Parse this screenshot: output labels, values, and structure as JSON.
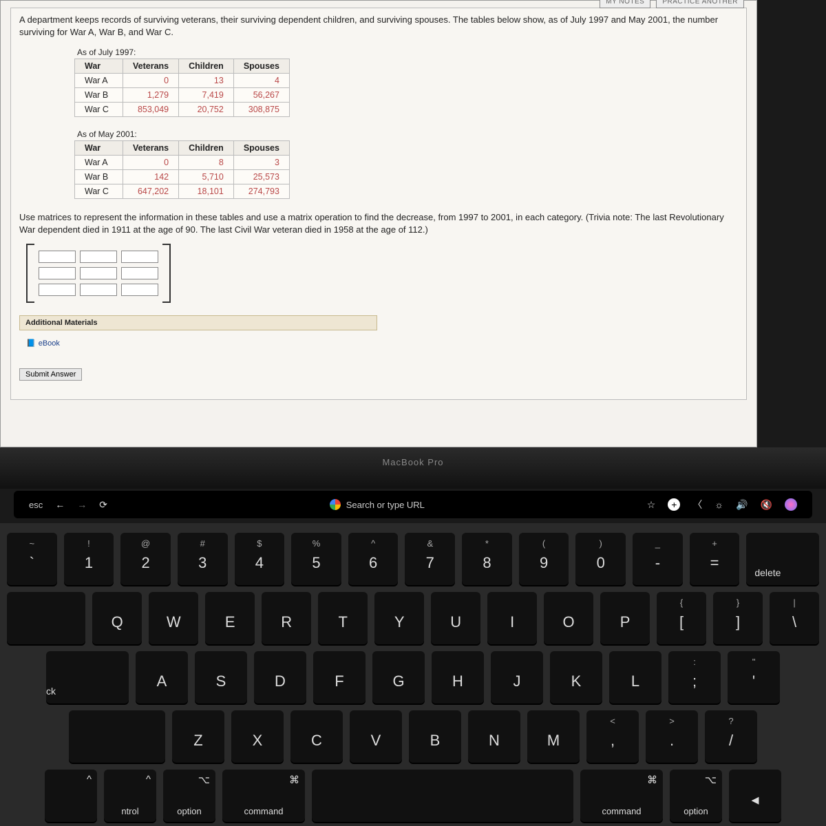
{
  "topButtons": {
    "notes": "MY NOTES",
    "practice": "PRACTICE ANOTHER"
  },
  "intro": "A department keeps records of surviving veterans, their surviving dependent children, and surviving spouses. The tables below show, as of July 1997 and May 2001, the number surviving for War A, War B, and War C.",
  "table1": {
    "caption": "As of July 1997:",
    "headers": [
      "War",
      "Veterans",
      "Children",
      "Spouses"
    ],
    "rows": [
      [
        "War A",
        "0",
        "13",
        "4"
      ],
      [
        "War B",
        "1,279",
        "7,419",
        "56,267"
      ],
      [
        "War C",
        "853,049",
        "20,752",
        "308,875"
      ]
    ]
  },
  "table2": {
    "caption": "As of May 2001:",
    "headers": [
      "War",
      "Veterans",
      "Children",
      "Spouses"
    ],
    "rows": [
      [
        "War A",
        "0",
        "8",
        "3"
      ],
      [
        "War B",
        "142",
        "5,710",
        "25,573"
      ],
      [
        "War C",
        "647,202",
        "18,101",
        "274,793"
      ]
    ]
  },
  "instruction": "Use matrices to represent the information in these tables and use a matrix operation to find the decrease, from 1997 to 2001, in each category. (Trivia note: The last Revolutionary War dependent died in 1911 at the age of 90. The last Civil War veteran died in 1958 at the age of 112.)",
  "additional_label": "Additional Materials",
  "ebook_label": "eBook",
  "submit_label": "Submit Answer",
  "bezel": "MacBook Pro",
  "touchbar": {
    "esc": "esc",
    "search": "Search or type URL"
  },
  "keys": {
    "row1": [
      {
        "t": "~",
        "m": "`"
      },
      {
        "t": "!",
        "m": "1"
      },
      {
        "t": "@",
        "m": "2"
      },
      {
        "t": "#",
        "m": "3"
      },
      {
        "t": "$",
        "m": "4"
      },
      {
        "t": "%",
        "m": "5"
      },
      {
        "t": "^",
        "m": "6"
      },
      {
        "t": "&",
        "m": "7"
      },
      {
        "t": "*",
        "m": "8"
      },
      {
        "t": "(",
        "m": "9"
      },
      {
        "t": ")",
        "m": "0"
      },
      {
        "t": "_",
        "m": "-"
      },
      {
        "t": "+",
        "m": "="
      }
    ],
    "delete": "delete",
    "row2": [
      "Q",
      "W",
      "E",
      "R",
      "T",
      "Y",
      "U",
      "I",
      "O",
      "P"
    ],
    "row2_end": [
      {
        "t": "{",
        "m": "["
      },
      {
        "t": "}",
        "m": "]"
      },
      {
        "t": "|",
        "m": "\\"
      }
    ],
    "row3": [
      "A",
      "S",
      "D",
      "F",
      "G",
      "H",
      "J",
      "K",
      "L"
    ],
    "row3_end": [
      {
        "t": ":",
        "m": ";"
      },
      {
        "t": "\"",
        "m": "'"
      }
    ],
    "row4": [
      "Z",
      "X",
      "C",
      "V",
      "B",
      "N",
      "M"
    ],
    "row4_end": [
      {
        "t": "<",
        "m": ","
      },
      {
        "t": ">",
        "m": "."
      },
      {
        "t": "?",
        "m": "/"
      }
    ],
    "bottom": {
      "ctrl": "ntrol",
      "option": "option",
      "command": "command"
    },
    "caps": "ck",
    "ctrl_sym": "^",
    "opt_sym": "⌥",
    "cmd_sym": "⌘"
  }
}
